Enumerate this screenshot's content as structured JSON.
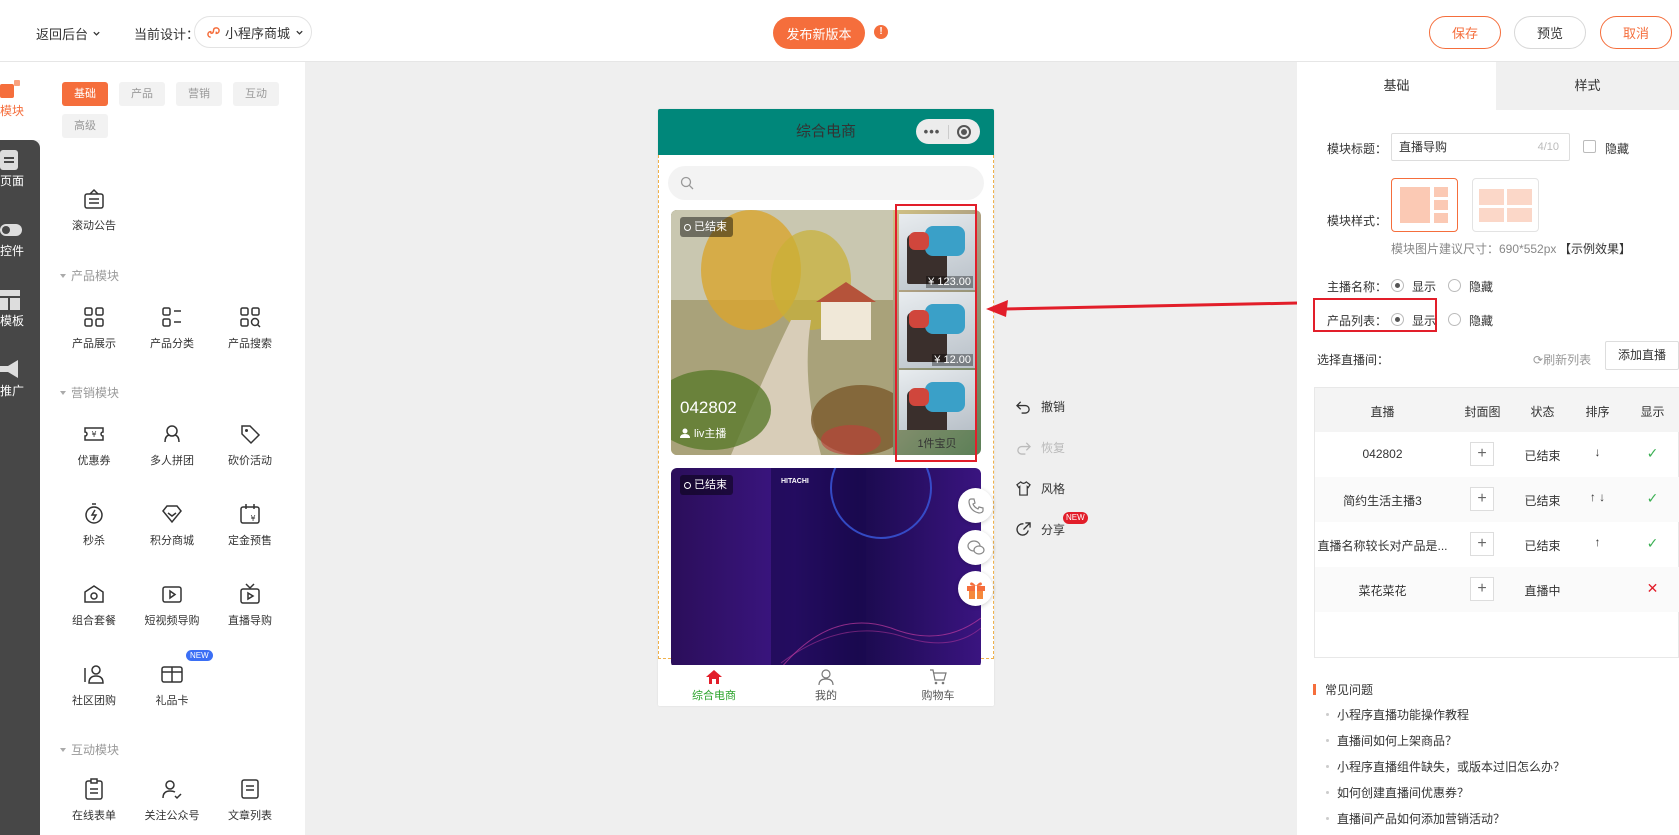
{
  "topbar": {
    "back_label": "返回后台",
    "current_design_label": "当前设计：",
    "design_name": "小程序商城",
    "publish_label": "发布新版本",
    "warn_symbol": "!",
    "save_label": "保存",
    "preview_label": "预览",
    "cancel_label": "取消"
  },
  "rail": {
    "items": [
      {
        "label": "模块",
        "icon": "module-icon"
      },
      {
        "label": "页面",
        "icon": "page-icon"
      },
      {
        "label": "控件",
        "icon": "toggle-icon"
      },
      {
        "label": "模板",
        "icon": "template-icon"
      },
      {
        "label": "推广",
        "icon": "megaphone-icon"
      }
    ]
  },
  "categories": [
    "基础",
    "产品",
    "营销",
    "互动",
    "高级"
  ],
  "modules": {
    "top": [
      {
        "label": "滚动公告"
      }
    ],
    "product_section": "产品模块",
    "product": [
      {
        "label": "产品展示"
      },
      {
        "label": "产品分类"
      },
      {
        "label": "产品搜索"
      }
    ],
    "marketing_section": "营销模块",
    "marketing": [
      {
        "label": "优惠券"
      },
      {
        "label": "多人拼团"
      },
      {
        "label": "砍价活动"
      },
      {
        "label": "秒杀"
      },
      {
        "label": "积分商城"
      },
      {
        "label": "定金预售"
      },
      {
        "label": "组合套餐"
      },
      {
        "label": "短视频导购"
      },
      {
        "label": "直播导购"
      },
      {
        "label": "社区团购"
      },
      {
        "label": "礼品卡"
      }
    ],
    "new_badge": "NEW",
    "interactive_section": "互动模块",
    "interactive": [
      {
        "label": "在线表单"
      },
      {
        "label": "关注公众号"
      },
      {
        "label": "文章列表"
      }
    ]
  },
  "phone": {
    "title": "综合电商",
    "capsule_dots": "•••",
    "card1": {
      "status": "已结束",
      "name": "042802",
      "host": "liv主播",
      "prices": [
        "¥ 123.00",
        "¥ 12.00"
      ],
      "count": "1件宝贝"
    },
    "card2": {
      "status": "已结束",
      "brand": "HITACHI"
    },
    "tabs": [
      {
        "label": "综合电商"
      },
      {
        "label": "我的"
      },
      {
        "label": "购物车"
      }
    ]
  },
  "actions": {
    "undo": "撤销",
    "redo": "恢复",
    "style": "风格",
    "share": "分享",
    "share_badge": "NEW"
  },
  "right": {
    "tabs": [
      "基础",
      "样式"
    ],
    "module_title_label": "模块标题：",
    "module_title_value": "直播导购",
    "module_title_count": "4/10",
    "hide_label": "隐藏",
    "module_style_label": "模块样式：",
    "img_hint": "模块图片建议尺寸：690*552px",
    "example_link": "【示例效果】",
    "host_name_label": "主播名称：",
    "product_list_label": "产品列表：",
    "show": "显示",
    "hide": "隐藏",
    "select_room_label": "选择直播间：",
    "refresh_label": "刷新列表",
    "add_live_label": "添加直播",
    "table_headers": [
      "直播",
      "封面图",
      "状态",
      "排序",
      "显示"
    ],
    "rows": [
      {
        "name": "042802",
        "status": "已结束",
        "sort": "↓",
        "show": "✓"
      },
      {
        "name": "简约生活主播3",
        "status": "已结束",
        "sort": "↑ ↓",
        "show": "✓"
      },
      {
        "name": "直播名称较长对产品是...",
        "status": "已结束",
        "sort": "↑",
        "show": "✓"
      },
      {
        "name": "菜花菜花",
        "status": "直播中",
        "sort": "",
        "show": "✕"
      }
    ],
    "plus": "+",
    "faq_title": "常见问题",
    "faq": [
      "小程序直播功能操作教程",
      "直播间如何上架商品？",
      "小程序直播组件缺失，或版本过旧怎么办？",
      "如何创建直播间优惠券？",
      "直播间产品如何添加营销活动？"
    ]
  },
  "colors": {
    "accent": "#f56e3c",
    "phone_header": "#00877a",
    "highlight": "#e21e2a",
    "tab_active": "#2aa32a"
  }
}
